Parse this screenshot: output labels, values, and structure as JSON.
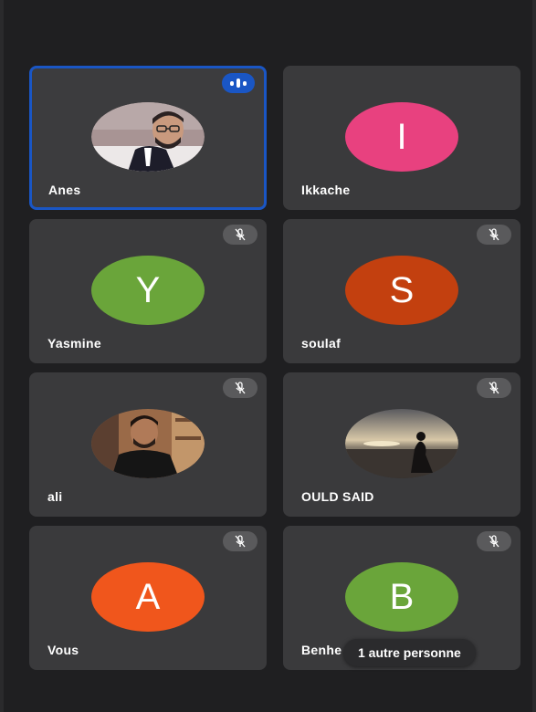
{
  "participants": [
    {
      "name": "Anes",
      "initial": "",
      "avatar_color": "#7a6a6a",
      "avatar_type": "photo-man-glasses",
      "status": "speaking"
    },
    {
      "name": "Ikkache",
      "initial": "I",
      "avatar_color": "#e8417f",
      "avatar_type": "initial",
      "status": "none"
    },
    {
      "name": "Yasmine",
      "initial": "Y",
      "avatar_color": "#6aa53a",
      "avatar_type": "initial",
      "status": "muted"
    },
    {
      "name": "soulaf",
      "initial": "S",
      "avatar_color": "#c3400f",
      "avatar_type": "initial",
      "status": "muted"
    },
    {
      "name": "ali",
      "initial": "",
      "avatar_color": "#8a5a3a",
      "avatar_type": "photo-man-tshirt",
      "status": "muted"
    },
    {
      "name": "OULD SAID",
      "initial": "",
      "avatar_color": "#4a4a4a",
      "avatar_type": "photo-silhouette-beach",
      "status": "muted"
    },
    {
      "name": "Vous",
      "initial": "A",
      "avatar_color": "#f0561c",
      "avatar_type": "initial",
      "status": "muted"
    },
    {
      "name": "Benhe",
      "initial": "B",
      "avatar_color": "#6aa53a",
      "avatar_type": "initial",
      "status": "muted"
    }
  ],
  "overflow_label": "1 autre personne",
  "icons": {
    "muted": "mic-off-icon",
    "speaking": "audio-level-icon"
  }
}
